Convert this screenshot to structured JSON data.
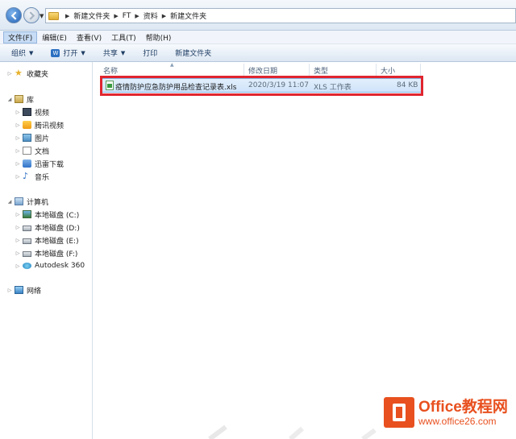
{
  "address": {
    "crumbs": [
      "新建文件夹",
      "FT",
      "资料",
      "新建文件夹"
    ]
  },
  "menu": [
    "文件(F)",
    "编辑(E)",
    "查看(V)",
    "工具(T)",
    "帮助(H)"
  ],
  "toolbar": {
    "organize": "组织",
    "open": "打开",
    "share": "共享",
    "print": "打印",
    "new_folder": "新建文件夹"
  },
  "nav": {
    "favorites": "收藏夹",
    "libraries": "库",
    "lib_items": [
      "视频",
      "腾讯视频",
      "图片",
      "文档",
      "迅雷下载",
      "音乐"
    ],
    "computer": "计算机",
    "drives": [
      "本地磁盘 (C:)",
      "本地磁盘 (D:)",
      "本地磁盘 (E:)",
      "本地磁盘 (F:)",
      "Autodesk 360"
    ],
    "network": "网络"
  },
  "columns": {
    "name": "名称",
    "modified": "修改日期",
    "type": "类型",
    "size": "大小"
  },
  "files": [
    {
      "name": "疫情防护应急防护用品检查记录表.xls",
      "modified": "2020/3/19 11:07",
      "type": "XLS 工作表",
      "size": "84 KB"
    }
  ],
  "watermark": {
    "title": "Office教程网",
    "url": "www.office26.com"
  },
  "colors": {
    "highlight": "#e0262f",
    "accent": "#e8501f",
    "selection": "#cfe3f9"
  }
}
